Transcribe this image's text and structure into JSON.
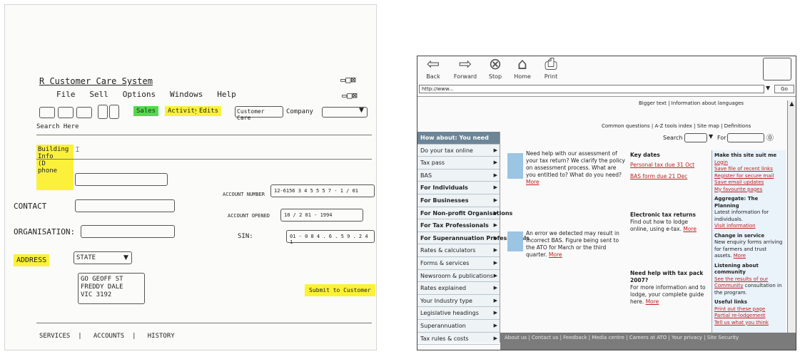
{
  "left": {
    "app_title": "R Customer Care System",
    "menu": [
      "File",
      "Sell",
      "Options",
      "Windows",
      "Help"
    ],
    "toolbar_labels": [
      "Sales",
      "Activity",
      "Edits"
    ],
    "customer_care_label": "Customer Care",
    "company_label": "Company",
    "search_label": "Search Here",
    "phone_note": "Building Info\n(D\nphone",
    "fields": {
      "contact": "CONTACT",
      "organisation": "ORGANISATION:",
      "address": "ADDRESS",
      "account_number": "ACCOUNT NUMBER",
      "account_value": "12-6156 3 4 5 5 5 7 - 1 / 01",
      "account_opened": "ACCOUNT OPENED",
      "opened_value": "10 / 2 01 - 1994",
      "sin": "SIN:",
      "sin_value": "01 - 0 8 4 . 6 . 5 9 . 2 4 1",
      "state": "STATE",
      "address_text": "GO GEOFF ST\nFREDDY DALE\nVIC 3192",
      "submit": "Submit to Customer"
    },
    "tabs": [
      "SERVICES",
      "ACCOUNTS",
      "HISTORY"
    ]
  },
  "right": {
    "nav": [
      "Back",
      "Forward",
      "Stop",
      "Home",
      "Print"
    ],
    "address_value": "http://www...",
    "go_label": "Go",
    "top_links": "Bigger text | Information about languages",
    "subtitle_links": "Common questions | A-Z tools index | Site map | Definitions",
    "search_label": "Search",
    "for_label": "For",
    "menu_header": "How about: You need",
    "menu_items": [
      {
        "label": "Do your tax online",
        "bold": false
      },
      {
        "label": "Tax pass",
        "bold": false
      },
      {
        "label": "BAS",
        "bold": false
      },
      {
        "label": "For Individuals",
        "bold": true
      },
      {
        "label": "For Businesses",
        "bold": true
      },
      {
        "label": "For Non-profit Organisations",
        "bold": true
      },
      {
        "label": "For Tax Professionals",
        "bold": true
      },
      {
        "label": "For Superannuation Professionals",
        "bold": true
      },
      {
        "label": "Rates & calculators",
        "bold": false
      },
      {
        "label": "Forms & services",
        "bold": false
      },
      {
        "label": "Newsroom & publications",
        "bold": false
      },
      {
        "label": "Rates explained",
        "bold": false
      },
      {
        "label": "Your Industry type",
        "bold": false
      },
      {
        "label": "Legislative headings",
        "bold": false
      },
      {
        "label": "Superannuation",
        "bold": false
      },
      {
        "label": "Tax rules & costs",
        "bold": false
      }
    ],
    "news": [
      {
        "text": "Need help with our assessment of your tax return? We clarify the policy on assessment process. What are you entitled to? What do you need?",
        "more": "More"
      },
      {
        "text": "An error we detected may result in incorrect BAS. Figure being sent to the ATO for March or the third quarter.",
        "more": "More"
      }
    ],
    "key_dates": {
      "title": "Key dates",
      "items": [
        "Personal tax due 31 Oct",
        "BAS form due 21 Dec"
      ]
    },
    "electronic": {
      "title": "Electronic tax returns",
      "text": "Find out how to lodge online, using e-tax.",
      "more": "More"
    },
    "help": {
      "title": "Need help with tax pack 2007?",
      "text": "For more information and to lodge, your complete guide here.",
      "more": "More"
    },
    "side": {
      "title": "Make this site suit me",
      "links": [
        "Login",
        "Save file of recent links",
        "Register for secure mail",
        "Save email updates",
        "My favourite pages"
      ],
      "aggregate_title": "Aggregate: The Planning",
      "aggregate_text": "Latest information for individuals.",
      "aggregate_link": "Visit information",
      "change_title": "Change in service",
      "change_text": "New enquiry forms arriving for farmers and trust assets.",
      "change_more": "More",
      "comm_title": "Listening about community",
      "comm_link": "See the results of our Community",
      "comm_text": "consultation in the program.",
      "useful_title": "Useful links",
      "useful_links": [
        "Print out these page",
        "Partial re-lodgement",
        "Tell us what you think"
      ]
    },
    "footer": "About us | Contact us | Feedback | Media centre | Careers at ATO | Your privacy | Site Security"
  }
}
